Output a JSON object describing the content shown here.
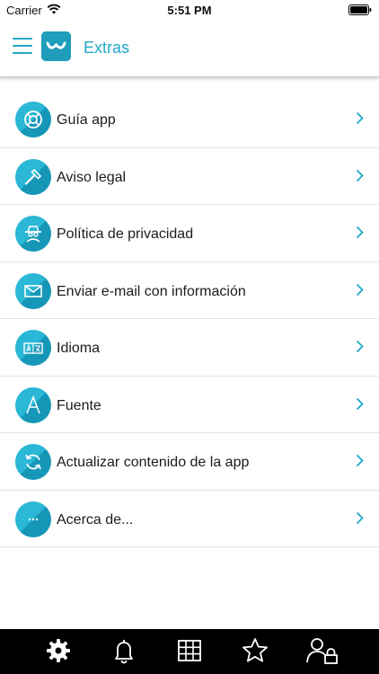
{
  "status": {
    "carrier": "Carrier",
    "time": "5:51 PM"
  },
  "header": {
    "title": "Extras",
    "menu_icon": "hamburger-icon",
    "logo": "app-logo"
  },
  "colors": {
    "accent": "#20a9c8",
    "accent_dark": "#1697b8",
    "tabbar": "#000000"
  },
  "items": [
    {
      "label": "Guía app",
      "icon": "lifebuoy-icon"
    },
    {
      "label": "Aviso legal",
      "icon": "gavel-icon"
    },
    {
      "label": "Política de privacidad",
      "icon": "spy-icon"
    },
    {
      "label": "Enviar e-mail con información",
      "icon": "envelope-icon"
    },
    {
      "label": "Idioma",
      "icon": "translate-icon"
    },
    {
      "label": "Fuente",
      "icon": "font-icon"
    },
    {
      "label": "Actualizar contenido de la app",
      "icon": "refresh-icon"
    },
    {
      "label": "Acerca de...",
      "icon": "ellipsis-icon"
    }
  ],
  "tabs": [
    {
      "icon": "gear-icon",
      "active": true
    },
    {
      "icon": "bell-icon"
    },
    {
      "icon": "grid-icon"
    },
    {
      "icon": "star-icon"
    },
    {
      "icon": "user-lock-icon"
    }
  ]
}
